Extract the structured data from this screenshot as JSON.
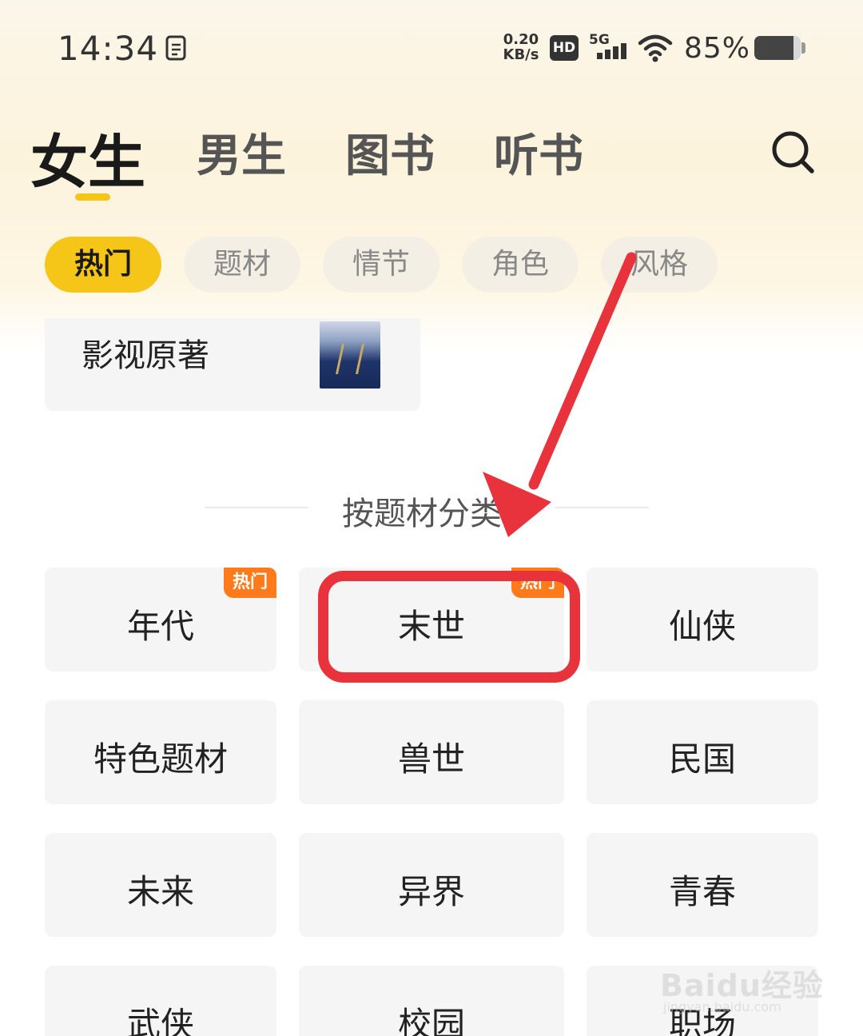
{
  "status_bar": {
    "time": "14:34",
    "net_speed_value": "0.20",
    "net_speed_unit": "KB/s",
    "hd_label": "HD",
    "network_label": "5G",
    "battery_text": "85%",
    "battery_level": 0.85
  },
  "main_tabs": [
    {
      "label": "女生",
      "active": true
    },
    {
      "label": "男生",
      "active": false
    },
    {
      "label": "图书",
      "active": false
    },
    {
      "label": "听书",
      "active": false
    }
  ],
  "sub_tabs": [
    {
      "label": "热门",
      "active": true
    },
    {
      "label": "题材",
      "active": false
    },
    {
      "label": "情节",
      "active": false
    },
    {
      "label": "角色",
      "active": false
    },
    {
      "label": "风格",
      "active": false
    }
  ],
  "film_card": {
    "label": "影视原著"
  },
  "section": {
    "title": "按题材分类"
  },
  "categories": [
    {
      "label": "年代",
      "badge": "热门"
    },
    {
      "label": "末世",
      "badge": "热门"
    },
    {
      "label": "仙侠",
      "badge": ""
    },
    {
      "label": "特色题材",
      "badge": ""
    },
    {
      "label": "兽世",
      "badge": ""
    },
    {
      "label": "民国",
      "badge": ""
    },
    {
      "label": "未来",
      "badge": ""
    },
    {
      "label": "异界",
      "badge": ""
    },
    {
      "label": "青春",
      "badge": ""
    },
    {
      "label": "武侠",
      "badge": ""
    },
    {
      "label": "校园",
      "badge": ""
    },
    {
      "label": "职场",
      "badge": ""
    }
  ],
  "watermark": {
    "brand": "Baidu经验",
    "url": "jingyan.baidu.com"
  },
  "colors": {
    "accent": "#f5c518",
    "hot_badge": "#ff7a1a",
    "annotation": "#e8323c"
  }
}
